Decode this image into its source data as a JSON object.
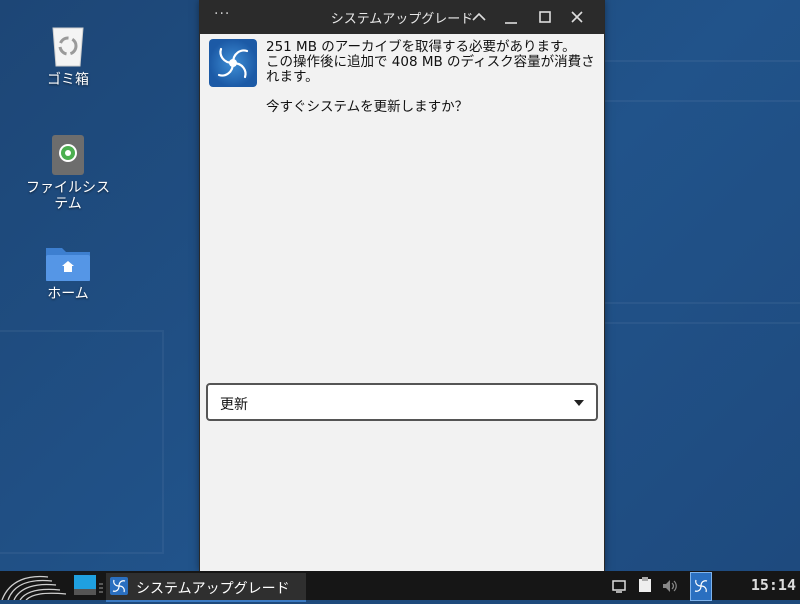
{
  "desktop": {
    "icons": [
      {
        "label": "ゴミ箱",
        "icon": "trash-icon"
      },
      {
        "label": "ファイルシステム",
        "icon": "filesystem-icon"
      },
      {
        "label": "ホーム",
        "icon": "home-folder-icon"
      }
    ]
  },
  "dialog": {
    "title": "システムアップグレード",
    "menu_label": "···",
    "message_line1": "251 MB のアーカイブを取得する必要があります。",
    "message_line2": "この操作後に追加で 408 MB のディスク容量が消費されます。",
    "message_question": "今すぐシステムを更新しますか？",
    "dropdown_selected": "更新"
  },
  "taskbar": {
    "task_label": "システムアップグレード",
    "clock": "15:14"
  },
  "colors": {
    "desktop_bg": "#1e4a7c",
    "titlebar": "#2b2b2b",
    "accent": "#3b7ac2"
  }
}
